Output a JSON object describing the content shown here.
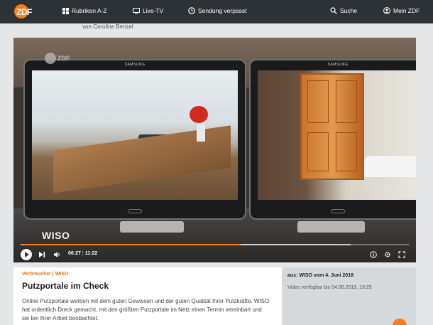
{
  "nav": {
    "logo": "ZDF",
    "rubriken": "Rubriken A-Z",
    "livetv": "Live-TV",
    "verpasst": "Sendung verpasst",
    "suche": "Suche",
    "meinzdf": "Mein ZDF"
  },
  "author": "von Caroline Benzel",
  "video": {
    "watermark": "ZDF",
    "show_logo": "WISO",
    "tablet_brand": "SAMSUNG",
    "current_time": "06:27",
    "duration": "11:22",
    "played_fraction": 0.567,
    "buffered_fraction": 0.85
  },
  "article": {
    "kicker": "Verbraucher | WISO",
    "title": "Putzportale im Check",
    "description": "Online Putzportale werben mit dem guten Gewissen und der guten Qualität ihrer Putzkräfte. WISO hat ordentlich Dreck gemacht, mit den größten Putzportale im Netz einen Termin vereinbart und sie bei ihrer Arbeit beobachtet."
  },
  "meta": {
    "aus": "aus: WISO vom 4. Juni 2018",
    "available": "Video verfügbar bis 04.06.2019, 19:25"
  },
  "colors": {
    "accent": "#fa7d19",
    "nav_bg": "#2d3237"
  }
}
